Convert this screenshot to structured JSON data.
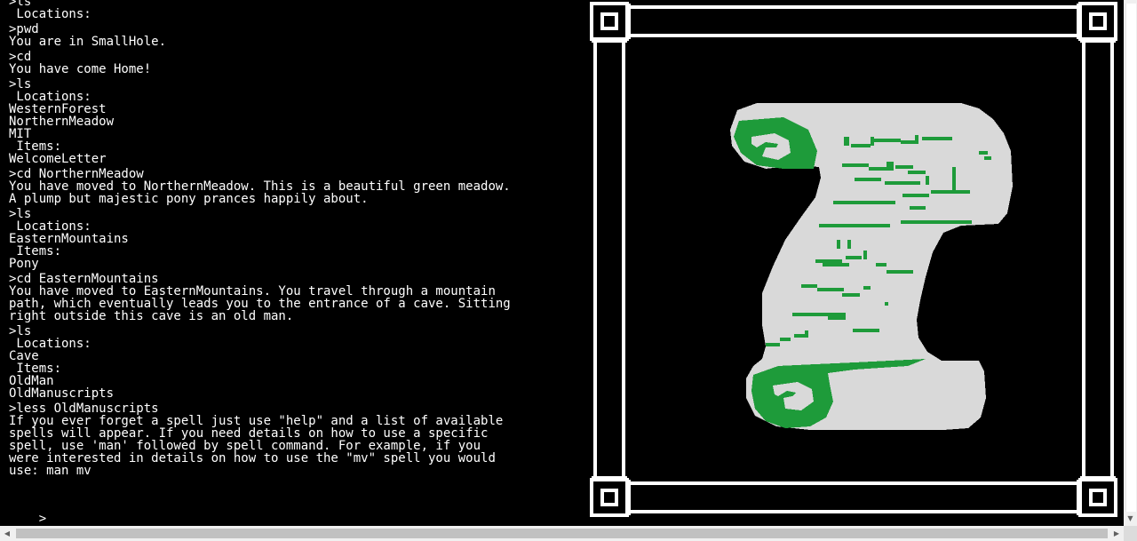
{
  "terminal": {
    "lines": [
      {
        "text": ">ls",
        "cmd": true
      },
      {
        "text": " Locations:",
        "cmd": false
      },
      {
        "text": ">pwd",
        "cmd": true
      },
      {
        "text": "You are in SmallHole.",
        "cmd": false
      },
      {
        "text": ">cd",
        "cmd": true
      },
      {
        "text": "You have come Home!",
        "cmd": false
      },
      {
        "text": ">ls",
        "cmd": true
      },
      {
        "text": " Locations:",
        "cmd": false
      },
      {
        "text": "WesternForest",
        "cmd": false
      },
      {
        "text": "NorthernMeadow",
        "cmd": false
      },
      {
        "text": "MIT",
        "cmd": false
      },
      {
        "text": " Items:",
        "cmd": false
      },
      {
        "text": "WelcomeLetter",
        "cmd": false
      },
      {
        "text": ">cd NorthernMeadow",
        "cmd": true
      },
      {
        "text": "You have moved to NorthernMeadow. This is a beautiful green meadow.",
        "cmd": false
      },
      {
        "text": "A plump but majestic pony prances happily about.",
        "cmd": false
      },
      {
        "text": ">ls",
        "cmd": true
      },
      {
        "text": " Locations:",
        "cmd": false
      },
      {
        "text": "EasternMountains",
        "cmd": false
      },
      {
        "text": " Items:",
        "cmd": false
      },
      {
        "text": "Pony",
        "cmd": false
      },
      {
        "text": ">cd EasternMountains",
        "cmd": true
      },
      {
        "text": "You have moved to EasternMountains. You travel through a mountain",
        "cmd": false
      },
      {
        "text": "path, which eventually leads you to the entrance of a cave. Sitting",
        "cmd": false
      },
      {
        "text": "right outside this cave is an old man.",
        "cmd": false
      },
      {
        "text": ">ls",
        "cmd": true
      },
      {
        "text": " Locations:",
        "cmd": false
      },
      {
        "text": "Cave",
        "cmd": false
      },
      {
        "text": " Items:",
        "cmd": false
      },
      {
        "text": "OldMan",
        "cmd": false
      },
      {
        "text": "OldManuscripts",
        "cmd": false
      },
      {
        "text": ">less OldManuscripts",
        "cmd": true
      },
      {
        "text": "If you ever forget a spell just use \"help\" and a list of available",
        "cmd": false
      },
      {
        "text": "spells will appear. If you need details on how to use a specific",
        "cmd": false
      },
      {
        "text": "spell, use 'man' followed by spell command. For example, if you",
        "cmd": false
      },
      {
        "text": "were interested in details on how to use the \"mv\" spell you would",
        "cmd": false
      },
      {
        "text": "use: man mv",
        "cmd": false
      }
    ],
    "prompt": ">",
    "input_value": ""
  },
  "art": {
    "subject": "scroll-icon",
    "frame_color": "#ffffff",
    "paper_color": "#d9d9d9",
    "ink_color": "#1e9b3a",
    "background": "#000000"
  },
  "scrollbars": {
    "up_arrow": "▲",
    "down_arrow": "▼",
    "left_arrow": "◀",
    "right_arrow": "▶"
  }
}
